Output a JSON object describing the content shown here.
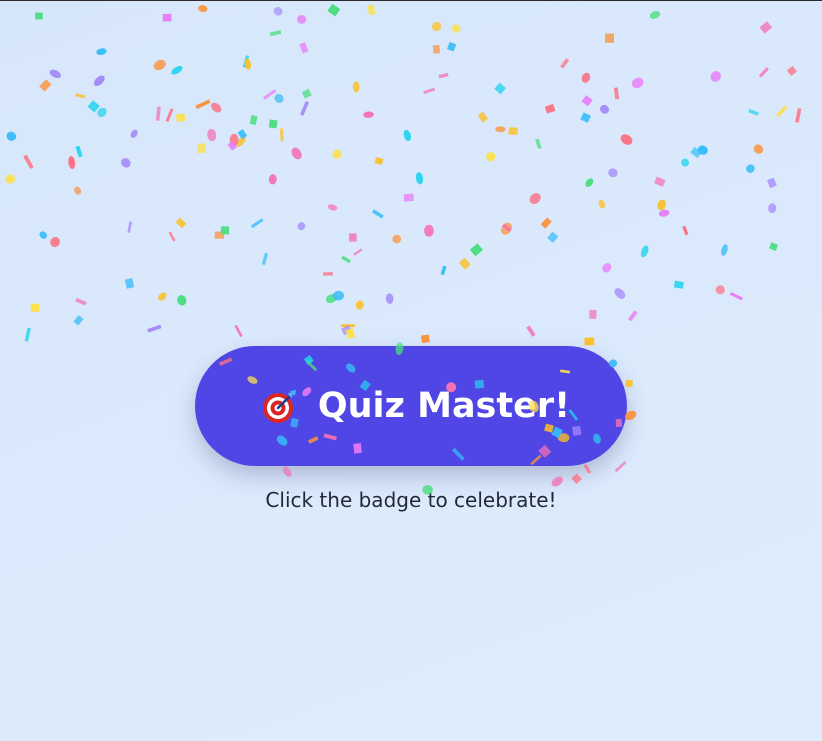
{
  "badge": {
    "icon": "dart-target-icon",
    "label": "Quiz Master!",
    "color": "#4f46e5"
  },
  "hint": {
    "text": "Click the badge to celebrate!"
  },
  "confetti": {
    "colors": [
      "#a78bfa",
      "#f472b6",
      "#fbbf24",
      "#4ade80",
      "#38bdf8",
      "#e879f9",
      "#fb7185",
      "#fde047",
      "#fb923c",
      "#22d3ee"
    ]
  }
}
